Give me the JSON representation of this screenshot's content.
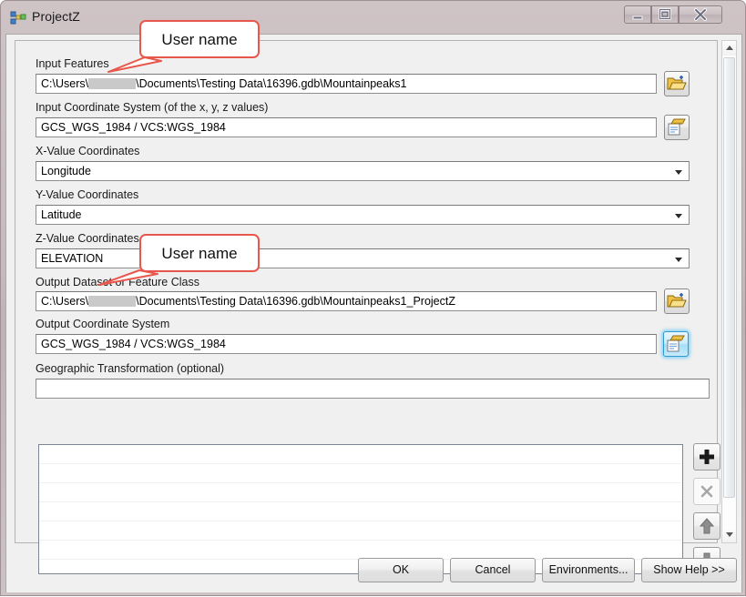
{
  "window": {
    "title": "ProjectZ",
    "icon": "geoprocessing-tool-icon",
    "controls": {
      "minimize": "minimize-icon",
      "maximize": "maximize-icon",
      "close": "close-icon"
    }
  },
  "form": {
    "fields": [
      {
        "label": "Input Features",
        "value_prefix": "C:\\Users\\",
        "value_suffix": "\\Documents\\Testing Data\\16396.gdb\\Mountainpeaks1",
        "redacted": true,
        "type": "text",
        "button": "open-folder-icon"
      },
      {
        "label": "Input Coordinate System (of the x, y, z values)",
        "value": "GCS_WGS_1984 / VCS:WGS_1984",
        "type": "text",
        "button": "select-coordinate-system-icon"
      },
      {
        "label": "X-Value Coordinates",
        "value": "Longitude",
        "type": "combo"
      },
      {
        "label": "Y-Value Coordinates",
        "value": "Latitude",
        "type": "combo"
      },
      {
        "label": "Z-Value Coordinates",
        "value": "ELEVATION",
        "type": "combo"
      },
      {
        "label": "Output Dataset or Feature Class",
        "value_prefix": "C:\\Users\\",
        "value_suffix": "\\Documents\\Testing Data\\16396.gdb\\Mountainpeaks1_ProjectZ",
        "redacted": true,
        "type": "text",
        "button": "open-folder-icon"
      },
      {
        "label": "Output Coordinate System",
        "value": "GCS_WGS_1984 / VCS:WGS_1984",
        "type": "text",
        "button": "select-coordinate-system-icon",
        "button_highlighted": true
      },
      {
        "label": "Geographic Transformation (optional)",
        "value": "",
        "type": "text"
      }
    ],
    "list": {
      "rows": 7,
      "items": []
    },
    "list_buttons": [
      {
        "name": "add-button",
        "icon": "plus-icon",
        "enabled": true
      },
      {
        "name": "remove-button",
        "icon": "cross-icon",
        "enabled": false
      },
      {
        "name": "move-up-button",
        "icon": "arrow-up-icon",
        "enabled": true
      },
      {
        "name": "move-down-button",
        "icon": "arrow-down-icon",
        "enabled": true
      }
    ]
  },
  "dialog_buttons": [
    {
      "label": "OK",
      "name": "ok-button"
    },
    {
      "label": "Cancel",
      "name": "cancel-button"
    },
    {
      "label": "Environments...",
      "name": "environments-button"
    },
    {
      "label": "Show Help >>",
      "name": "show-help-button"
    }
  ],
  "annotations": [
    {
      "text": "User name",
      "target": "input-features-path"
    },
    {
      "text": "User name",
      "target": "output-dataset-path"
    }
  ],
  "colors": {
    "annotation": "#e8574b",
    "highlight": "#3399cc",
    "window_frame": "#c6babd",
    "panel_bg": "#f0f0f0"
  }
}
